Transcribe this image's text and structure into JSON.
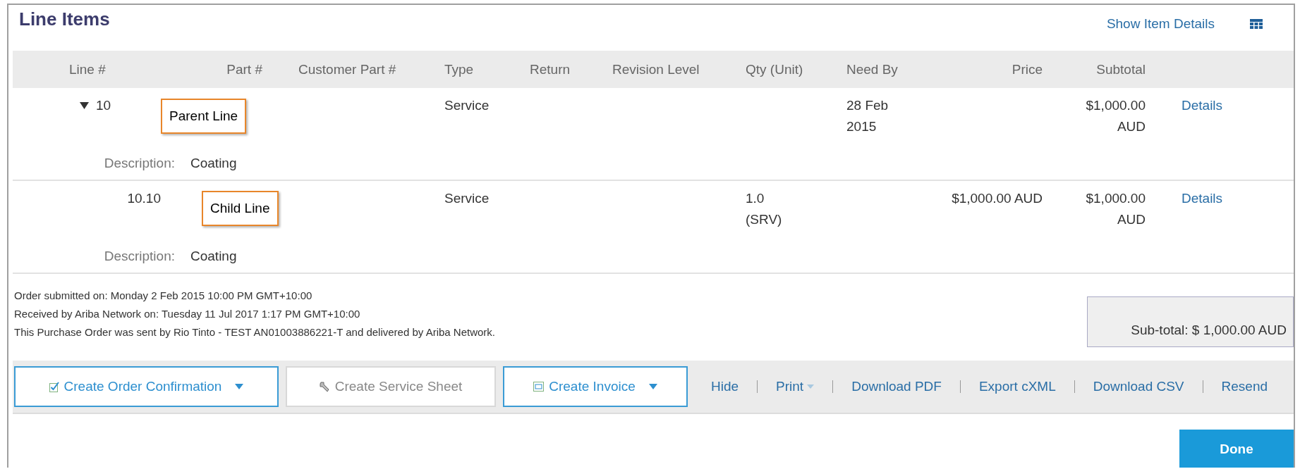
{
  "panel": {
    "title": "Line Items",
    "show_details_link": "Show Item Details"
  },
  "table": {
    "columns": [
      "Line #",
      "Part #",
      "Customer Part #",
      "Type",
      "Return",
      "Revision Level",
      "Qty (Unit)",
      "Need By",
      "Price",
      "Subtotal"
    ],
    "rows": [
      {
        "line": "10",
        "expanded": true,
        "callout": "Parent Line",
        "type": "Service",
        "need_by": "28 Feb\n2015",
        "subtotal": "$1,000.00\nAUD",
        "action": "Details",
        "description_label": "Description:",
        "description": "Coating",
        "children": [
          {
            "line": "10.10",
            "callout": "Child Line",
            "type": "Service",
            "qty": "1.0\n(SRV)",
            "price": "$1,000.00 AUD",
            "subtotal": "$1,000.00\nAUD",
            "action": "Details",
            "description_label": "Description:",
            "description": "Coating"
          }
        ]
      }
    ]
  },
  "order_info": [
    "Order submitted on: Monday 2 Feb 2015 10:00 PM GMT+10:00",
    "Received by Ariba Network on: Tuesday 11 Jul 2017 1:17 PM GMT+10:00",
    "This Purchase Order was sent by Rio Tinto - TEST AN01003886221-T and delivered by Ariba Network."
  ],
  "subtotal": "Sub-total: $ 1,000.00 AUD",
  "toolbar": {
    "buttons": [
      {
        "label": "Create Order Confirmation",
        "disabled": false,
        "dropdown": true
      },
      {
        "label": "Create Service Sheet",
        "disabled": true,
        "dropdown": false
      },
      {
        "label": "Create Invoice",
        "disabled": false,
        "dropdown": true
      }
    ],
    "links": [
      {
        "label": "Hide",
        "dropdown": false
      },
      {
        "label": "Print",
        "dropdown": true
      },
      {
        "label": "Download PDF",
        "dropdown": false
      },
      {
        "label": "Export cXML",
        "dropdown": false
      },
      {
        "label": "Download CSV",
        "dropdown": false
      },
      {
        "label": "Resend",
        "dropdown": false
      }
    ]
  },
  "done_button": "Done"
}
